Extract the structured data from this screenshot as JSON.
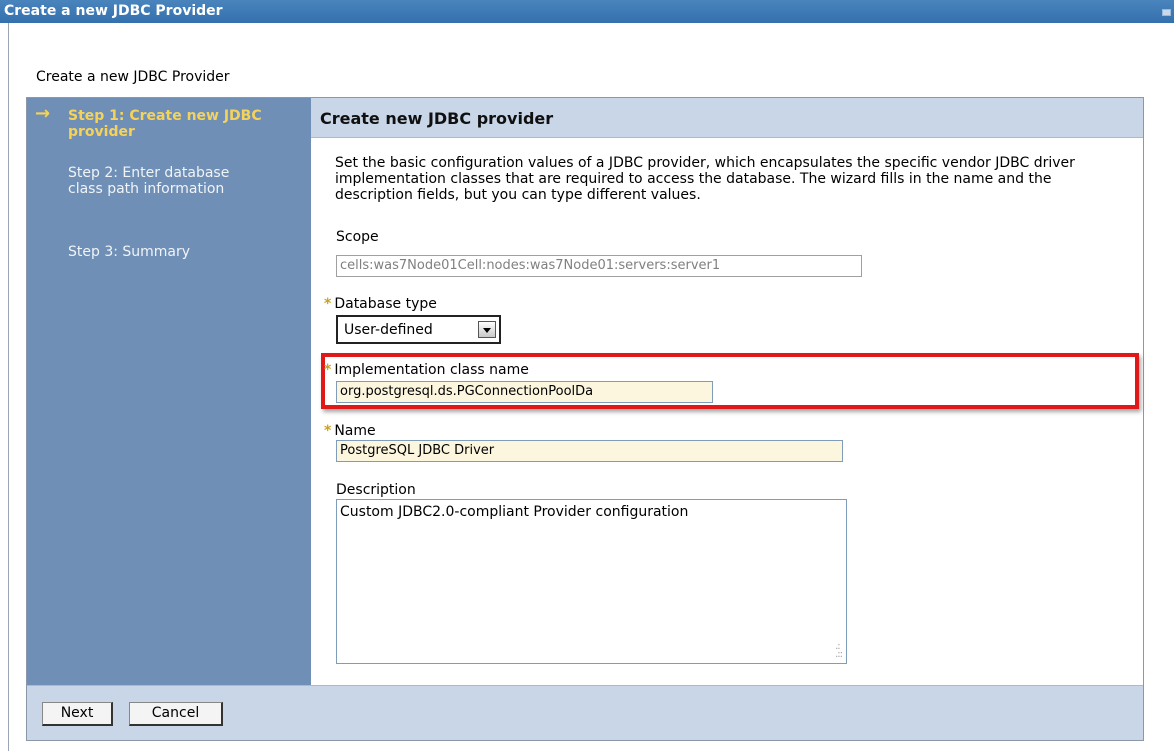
{
  "window": {
    "title": "Create a new JDBC Provider"
  },
  "page": {
    "label": "Create a new JDBC Provider"
  },
  "steps": [
    {
      "label": "Step 1: Create new JDBC provider",
      "current": true
    },
    {
      "label": "Step 2: Enter database class path information",
      "current": false
    },
    {
      "label": "Step 3: Summary",
      "current": false
    }
  ],
  "panel": {
    "title": "Create new JDBC provider",
    "intro": "Set the basic configuration values of a JDBC provider, which encapsulates the specific vendor JDBC driver implementation classes that are required to access the database. The wizard fills in the name and the description fields, but you can type different values."
  },
  "form": {
    "scope": {
      "label": "Scope",
      "value": "cells:was7Node01Cell:nodes:was7Node01:servers:server1"
    },
    "database_type": {
      "label": "Database type",
      "value": "User-defined",
      "required_mark": "*"
    },
    "implementation_class": {
      "label": "Implementation class name",
      "value": "org.postgresql.ds.PGConnectionPoolDa",
      "required_mark": "*"
    },
    "name": {
      "label": "Name",
      "value": "PostgreSQL JDBC Driver",
      "required_mark": "*"
    },
    "description": {
      "label": "Description",
      "value": "Custom JDBC2.0-compliant Provider configuration"
    }
  },
  "buttons": {
    "next": "Next",
    "cancel": "Cancel"
  },
  "colors": {
    "title_bar": "#3a78b5",
    "steps_panel": "#6f8fb6",
    "current_step": "#f5d35a",
    "header_band": "#c8d6e7",
    "highlight_border": "#e01818"
  }
}
